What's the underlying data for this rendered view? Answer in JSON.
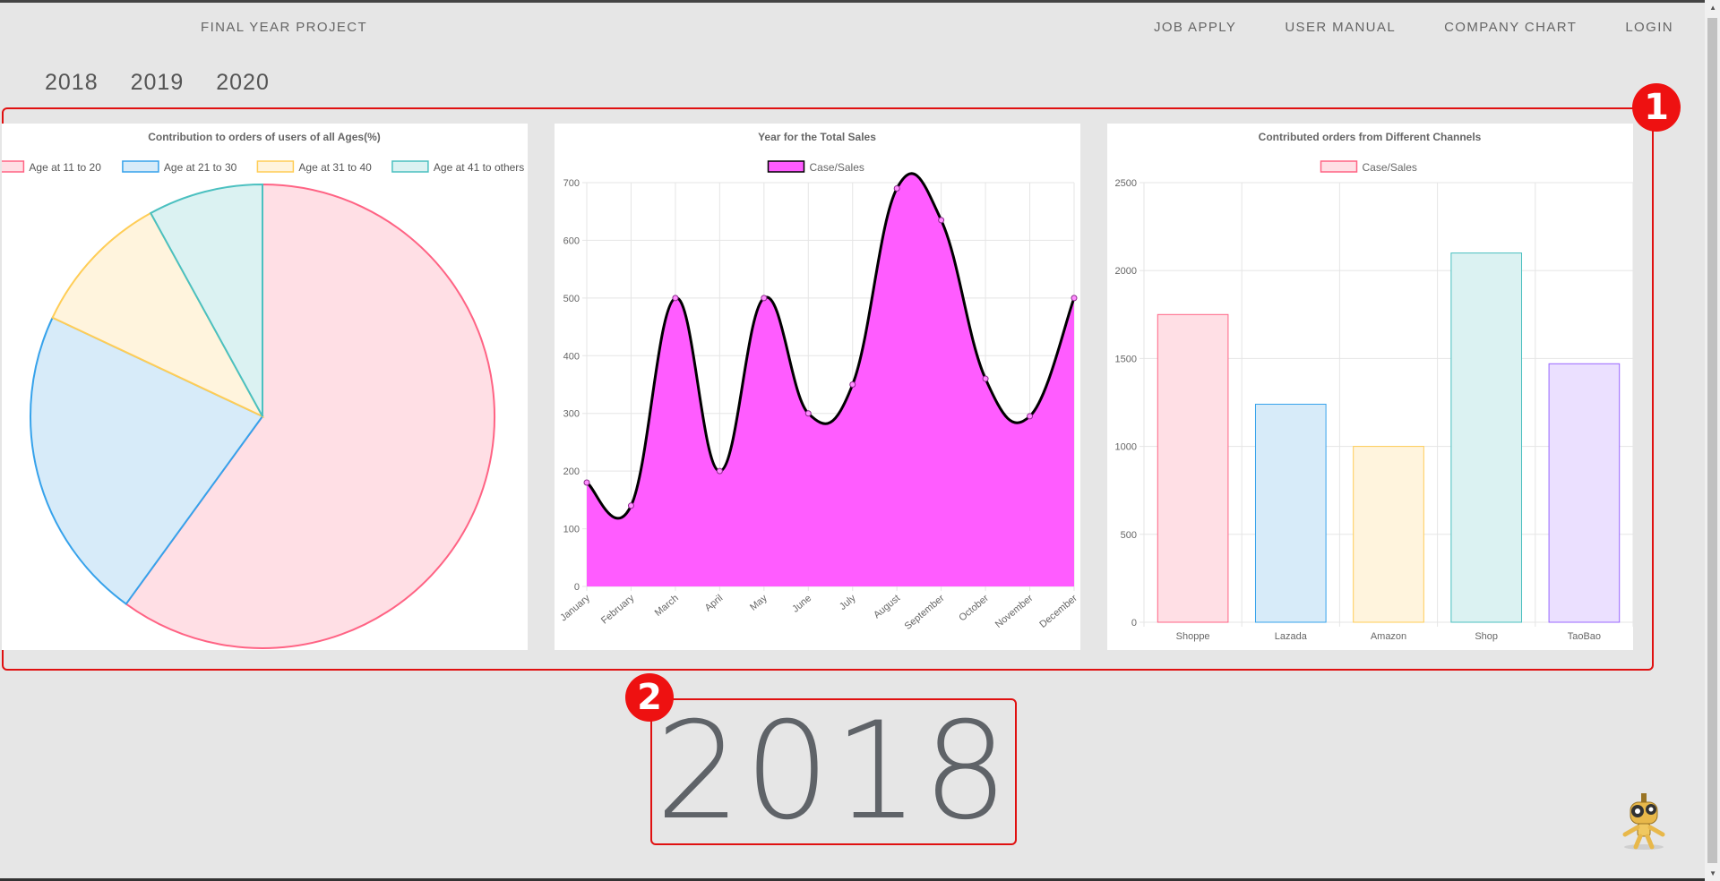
{
  "nav": {
    "brand": "FINAL YEAR PROJECT",
    "links": [
      "JOB APPLY",
      "USER MANUAL",
      "COMPANY CHART",
      "LOGIN"
    ]
  },
  "years": [
    "2018",
    "2019",
    "2020"
  ],
  "selected_year": "2018",
  "badges": [
    "1",
    "2"
  ],
  "icons": {
    "mascot": "robot-mascot-icon"
  },
  "chart_data": [
    {
      "type": "pie",
      "title": "Contribution to orders of users of all Ages(%)",
      "labels": [
        "Age at 11 to 20",
        "Age at 21 to 30",
        "Age at 31 to 40",
        "Age at 41 to others"
      ],
      "values": [
        60,
        22,
        10,
        8
      ],
      "colors": [
        "#ff6384",
        "#36a2eb",
        "#ffcd56",
        "#4bc0c0"
      ],
      "fills": [
        "#ffdfe5",
        "#d7ebf9",
        "#fff4dd",
        "#dbf2f2"
      ],
      "legend": "top"
    },
    {
      "type": "area",
      "title": "Year for the Total Sales",
      "categories": [
        "January",
        "February",
        "March",
        "April",
        "May",
        "June",
        "July",
        "August",
        "September",
        "October",
        "November",
        "December"
      ],
      "series": [
        {
          "name": "Case/Sales",
          "values": [
            180,
            140,
            500,
            200,
            500,
            300,
            350,
            690,
            635,
            360,
            295,
            500
          ]
        }
      ],
      "ylim": [
        0,
        700
      ],
      "yticks": [
        0,
        100,
        200,
        300,
        400,
        500,
        600,
        700
      ],
      "fill": "#ff5cff",
      "stroke": "#000000",
      "grid": true,
      "legend": "top"
    },
    {
      "type": "bar",
      "title": "Contributed orders from Different  Channels",
      "categories": [
        "Shoppe",
        "Lazada",
        "Amazon",
        "Shop",
        "TaoBao"
      ],
      "series": [
        {
          "name": "Case/Sales",
          "values": [
            1750,
            1240,
            1000,
            2100,
            1470
          ]
        }
      ],
      "ylim": [
        0,
        2500
      ],
      "yticks": [
        0,
        500,
        1000,
        1500,
        2000,
        2500
      ],
      "colors": [
        "#ff6384",
        "#36a2eb",
        "#ffcd56",
        "#4bc0c0",
        "#9966ff"
      ],
      "fills": [
        "#ffdfe5",
        "#d7ebf9",
        "#fff4dd",
        "#dbf2f2",
        "#ebe0ff"
      ],
      "grid": true,
      "legend": "top"
    }
  ]
}
